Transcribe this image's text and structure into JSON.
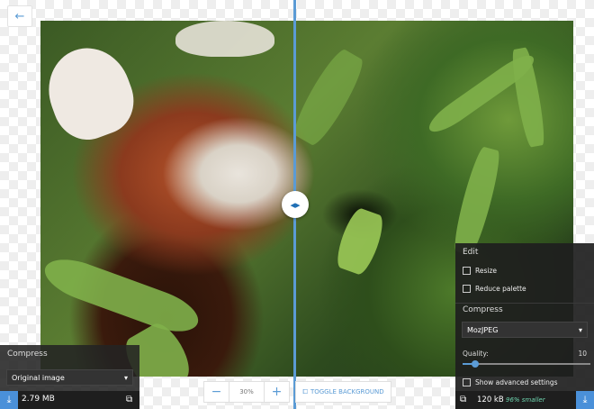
{
  "nav": {
    "back_icon": "arrow-left-icon"
  },
  "left_panel": {
    "heading": "Compress",
    "method": "Original image",
    "file_size": "2.79 MB"
  },
  "zoom": {
    "minus": "−",
    "value": "30%",
    "plus": "+"
  },
  "toggle_background": {
    "label": "TOGGLE BACKGROUND"
  },
  "right_panel": {
    "edit_heading": "Edit",
    "resize_label": "Resize",
    "reduce_palette_label": "Reduce palette",
    "compress_heading": "Compress",
    "method": "MozJPEG",
    "quality_label": "Quality:",
    "quality_value": "10",
    "quality_fraction": 0.1,
    "advanced_label": "Show advanced settings",
    "file_size": "120 kB",
    "savings": "96% smaller"
  },
  "colors": {
    "accent": "#5b9bd5",
    "savings_text": "#6fd6b0"
  }
}
